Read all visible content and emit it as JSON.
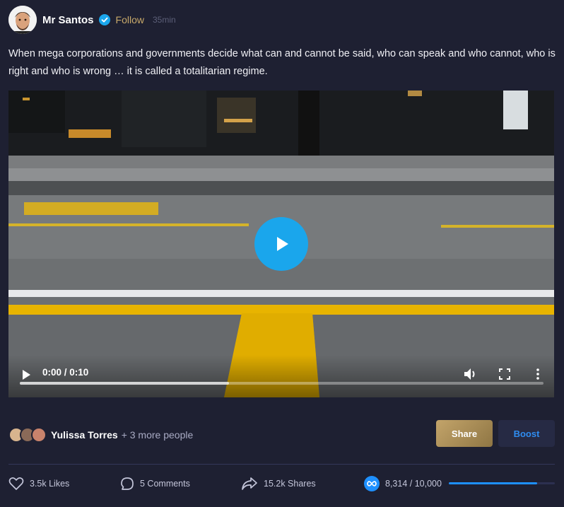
{
  "post": {
    "author": "Mr Santos",
    "follow_label": "Follow",
    "time": "35min",
    "text": "When mega corporations and governments decide what can and cannot be said, who can speak and who cannot, who is right and who is wrong … it is called a totalitarian regime."
  },
  "video": {
    "timecode": "0:00 / 0:10",
    "buffered_fraction": 0.4
  },
  "reactions": {
    "name": "Yulissa Torres",
    "more": "+ 3 more people"
  },
  "actions": {
    "share_label": "Share",
    "boost_label": "Boost"
  },
  "stats": {
    "likes": "3.5k Likes",
    "comments": "5 Comments",
    "shares": "15.2k Shares",
    "boost_progress": "8,314 / 10,000",
    "boost_fraction": 0.8314
  },
  "colors": {
    "accent_gold": "#c3a46a",
    "accent_blue": "#1e90ff",
    "play_button": "#1aa6ec",
    "background": "#1e2032"
  }
}
